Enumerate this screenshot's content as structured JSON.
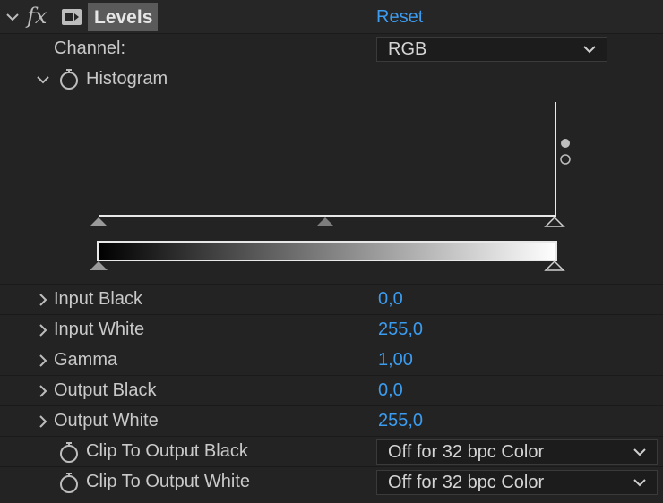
{
  "header": {
    "fx_label": "fx",
    "effect_name": "Levels",
    "reset_label": "Reset"
  },
  "channel": {
    "label": "Channel:",
    "value": "RGB"
  },
  "histogram": {
    "label": "Histogram"
  },
  "properties": [
    {
      "label": "Input Black",
      "value": "0,0"
    },
    {
      "label": "Input White",
      "value": "255,0"
    },
    {
      "label": "Gamma",
      "value": "1,00"
    },
    {
      "label": "Output Black",
      "value": "0,0"
    },
    {
      "label": "Output White",
      "value": "255,0"
    }
  ],
  "clip": [
    {
      "label": "Clip To Output Black",
      "value": "Off for 32 bpc Color"
    },
    {
      "label": "Clip To Output White",
      "value": "Off for 32 bpc Color"
    }
  ],
  "colors": {
    "accent": "#3b9cf0",
    "background": "#232323"
  }
}
